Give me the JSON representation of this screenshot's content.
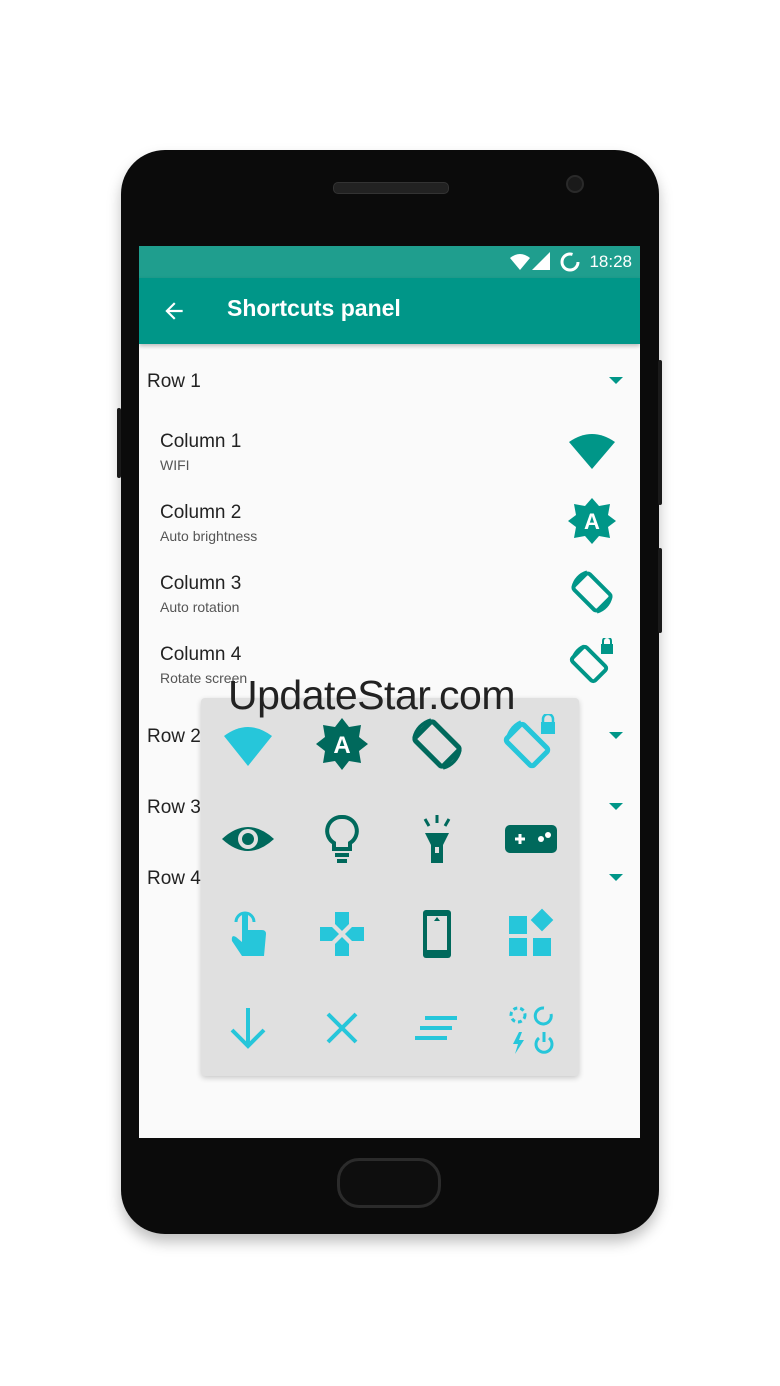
{
  "statusbar": {
    "time": "18:28"
  },
  "toolbar": {
    "title": "Shortcuts panel",
    "back_icon": "arrow-back-icon"
  },
  "colors": {
    "primary": "#009688",
    "status": "#1f9e8e",
    "teal_dark": "#00695c",
    "cyan": "#26c6da",
    "overlay": "#e0e0e0"
  },
  "rows": [
    {
      "label": "Row 1",
      "expanded": true,
      "columns": [
        {
          "title": "Column 1",
          "subtitle": "WIFI",
          "icon": "wifi-icon"
        },
        {
          "title": "Column 2",
          "subtitle": "Auto brightness",
          "icon": "auto-brightness-icon"
        },
        {
          "title": "Column 3",
          "subtitle": "Auto rotation",
          "icon": "auto-rotation-icon"
        },
        {
          "title": "Column 4",
          "subtitle": "Rotate screen",
          "icon": "rotate-lock-icon"
        }
      ]
    },
    {
      "label": "Row 2",
      "expanded": false
    },
    {
      "label": "Row 3",
      "expanded": false
    },
    {
      "label": "Row 4",
      "expanded": false
    }
  ],
  "icon_grid": [
    "wifi-icon",
    "auto-brightness-icon",
    "auto-rotation-icon",
    "rotate-lock-icon",
    "eye-icon",
    "lightbulb-icon",
    "flashlight-icon",
    "gamepad-icon",
    "touch-icon",
    "dpad-icon",
    "phone-screen-icon",
    "widgets-icon",
    "arrow-down-icon",
    "close-icon",
    "lines-icon",
    "power-actions-icon"
  ],
  "watermark": "UpdateStar.com"
}
